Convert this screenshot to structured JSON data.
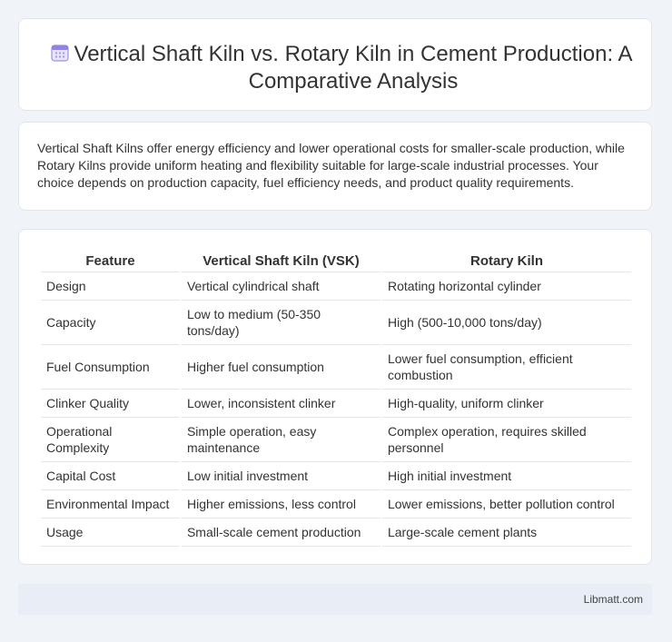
{
  "header": {
    "icon": "calendar-icon",
    "title": "Vertical Shaft Kiln vs. Rotary Kiln in Cement Production: A Comparative Analysis"
  },
  "summary": "Vertical Shaft Kilns offer energy efficiency and lower operational costs for smaller-scale production, while Rotary Kilns provide uniform heating and flexibility suitable for large-scale industrial processes. Your choice depends on production capacity, fuel efficiency needs, and product quality requirements.",
  "table": {
    "headers": [
      "Feature",
      "Vertical Shaft Kiln (VSK)",
      "Rotary Kiln"
    ],
    "rows": [
      [
        "Design",
        "Vertical cylindrical shaft",
        "Rotating horizontal cylinder"
      ],
      [
        "Capacity",
        "Low to medium (50-350 tons/day)",
        "High (500-10,000 tons/day)"
      ],
      [
        "Fuel Consumption",
        "Higher fuel consumption",
        "Lower fuel consumption, efficient combustion"
      ],
      [
        "Clinker Quality",
        "Lower, inconsistent clinker",
        "High-quality, uniform clinker"
      ],
      [
        "Operational Complexity",
        "Simple operation, easy maintenance",
        "Complex operation, requires skilled personnel"
      ],
      [
        "Capital Cost",
        "Low initial investment",
        "High initial investment"
      ],
      [
        "Environmental Impact",
        "Higher emissions, less control",
        "Lower emissions, better pollution control"
      ],
      [
        "Usage",
        "Small-scale cement production",
        "Large-scale cement plants"
      ]
    ]
  },
  "footer": {
    "brand": "Libmatt.com"
  },
  "colors": {
    "accent": "#7b6fd6",
    "background": "#f0f3f8",
    "footer": "#e8edf6"
  }
}
